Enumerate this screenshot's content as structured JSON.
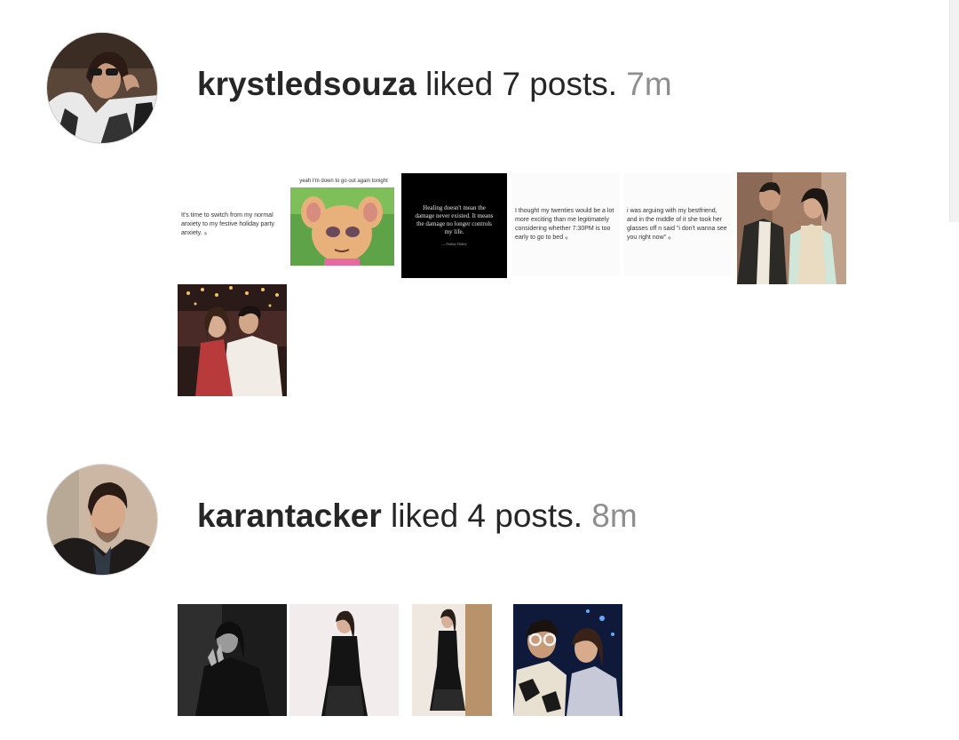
{
  "activities": [
    {
      "username": "krystledsouza",
      "action": "liked 7 posts.",
      "time": "7m",
      "avatar_alt": "avatar",
      "posts": [
        {
          "kind": "quote",
          "text": "It's time to switch from my normal anxiety to my festive holiday party anxiety."
        },
        {
          "kind": "cartoon",
          "caption": "yeah I'm down to go out again tonight"
        },
        {
          "kind": "black-quote",
          "text": "Healing doesn't mean the damage never existed. It means the damage no longer controls my life.",
          "attribution": "— Akshay Dubey"
        },
        {
          "kind": "quote",
          "text": "I thought my twenties would be a lot more exciting than me legitimately considering whether 7:30PM is too early to go to bed"
        },
        {
          "kind": "quote",
          "text": "i was arguing with my bestfriend, and in the middle of it she took her glasses off n said \"i don't wanna see you right now\""
        },
        {
          "kind": "photo"
        },
        {
          "kind": "photo"
        }
      ]
    },
    {
      "username": "karantacker",
      "action": "liked 4 posts.",
      "time": "8m",
      "avatar_alt": "avatar",
      "posts": [
        {
          "kind": "photo"
        },
        {
          "kind": "photo"
        },
        {
          "kind": "photo"
        },
        {
          "kind": "photo"
        }
      ]
    }
  ]
}
